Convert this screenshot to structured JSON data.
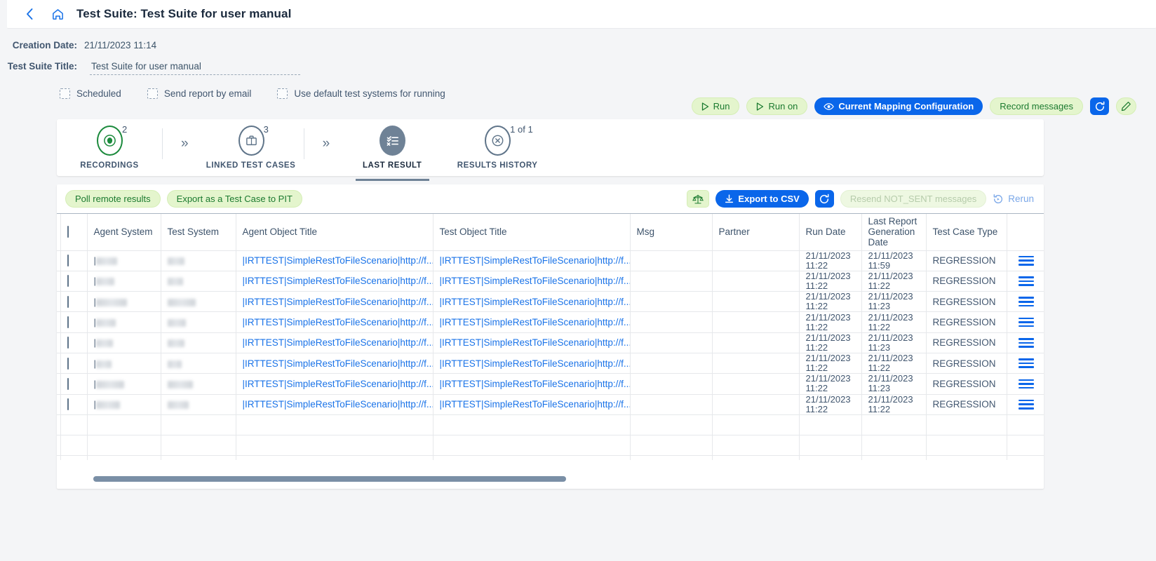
{
  "header": {
    "back_icon": "chevron-left-icon",
    "home_icon": "home-icon",
    "title": "Test Suite: Test Suite for user manual"
  },
  "meta": {
    "creation_date_label": "Creation Date:",
    "creation_date_value": "21/11/2023 11:14",
    "test_suite_title_label": "Test Suite Title:",
    "test_suite_title_value": "Test Suite for user manual",
    "checkboxes": [
      {
        "label": "Scheduled",
        "checked": false
      },
      {
        "label": "Send report by email",
        "checked": false
      },
      {
        "label": "Use default test systems for running",
        "checked": false
      }
    ]
  },
  "actions": {
    "run": "Run",
    "run_on": "Run on",
    "current_mapping_configuration": "Current Mapping Configuration",
    "record_messages": "Record messages",
    "refresh_icon": "refresh-icon",
    "edit_icon": "pencil-icon"
  },
  "stepper": {
    "steps": [
      {
        "label": "RECORDINGS",
        "badge": "2",
        "icon": "record-dot-icon",
        "style": "outline-green",
        "active": false
      },
      {
        "label": "LINKED TEST CASES",
        "badge": "3",
        "icon": "briefcase-icon",
        "style": "outline-grey",
        "active": false
      },
      {
        "label": "LAST RESULT",
        "badge": "",
        "icon": "checklist-icon",
        "style": "filled",
        "active": true
      },
      {
        "label": "RESULTS HISTORY",
        "badge": "1 of 1",
        "icon": "x-circle-icon",
        "style": "outline-grey",
        "active": false
      }
    ],
    "separator_glyph": "»"
  },
  "table_toolbar": {
    "poll_remote_results": "Poll remote results",
    "export_as_test_case_to_pit": "Export as a Test Case to PIT",
    "compare_icon": "scales-icon",
    "export_to_csv": "Export to CSV",
    "export_icon": "download-icon",
    "refresh_icon": "refresh-icon",
    "resend_not_sent_messages": "Resend NOT_SENT messages",
    "rerun": "Rerun",
    "rerun_icon": "rerun-icon"
  },
  "table": {
    "columns": [
      "Agent System",
      "Test System",
      "Agent Object Title",
      "Test Object Title",
      "Msg",
      "Partner",
      "Run Date",
      "Last Report Generation Date",
      "Test Case Type"
    ],
    "select_all_checked": false,
    "rows": [
      {
        "status": "green",
        "agent_system": "",
        "test_system": "",
        "agent_object_title": "|IRTTEST|SimpleRestToFileScenario|http://f...",
        "test_object_title": "|IRTTEST|SimpleRestToFileScenario|http://f...",
        "msg": "",
        "partner": "",
        "run_date": "21/11/2023 11:22",
        "last_report_generation_date": "21/11/2023 11:59",
        "test_case_type": "REGRESSION"
      },
      {
        "status": "red",
        "agent_system": "",
        "test_system": "",
        "agent_object_title": "|IRTTEST|SimpleRestToFileScenario|http://f...",
        "test_object_title": "|IRTTEST|SimpleRestToFileScenario|http://f...",
        "msg": "",
        "partner": "",
        "run_date": "21/11/2023 11:22",
        "last_report_generation_date": "21/11/2023 11:22",
        "test_case_type": "REGRESSION"
      },
      {
        "status": "red",
        "agent_system": "",
        "test_system": "",
        "agent_object_title": "|IRTTEST|SimpleRestToFileScenario|http://f...",
        "test_object_title": "|IRTTEST|SimpleRestToFileScenario|http://f...",
        "msg": "",
        "partner": "",
        "run_date": "21/11/2023 11:22",
        "last_report_generation_date": "21/11/2023 11:23",
        "test_case_type": "REGRESSION"
      },
      {
        "status": "red",
        "agent_system": "",
        "test_system": "",
        "agent_object_title": "|IRTTEST|SimpleRestToFileScenario|http://f...",
        "test_object_title": "|IRTTEST|SimpleRestToFileScenario|http://f...",
        "msg": "",
        "partner": "",
        "run_date": "21/11/2023 11:22",
        "last_report_generation_date": "21/11/2023 11:22",
        "test_case_type": "REGRESSION"
      },
      {
        "status": "green",
        "agent_system": "",
        "test_system": "",
        "agent_object_title": "|IRTTEST|SimpleRestToFileScenario|http://f...",
        "test_object_title": "|IRTTEST|SimpleRestToFileScenario|http://f...",
        "msg": "",
        "partner": "",
        "run_date": "21/11/2023 11:22",
        "last_report_generation_date": "21/11/2023 11:23",
        "test_case_type": "REGRESSION"
      },
      {
        "status": "green",
        "agent_system": "",
        "test_system": "",
        "agent_object_title": "|IRTTEST|SimpleRestToFileScenario|http://f...",
        "test_object_title": "|IRTTEST|SimpleRestToFileScenario|http://f...",
        "msg": "",
        "partner": "",
        "run_date": "21/11/2023 11:22",
        "last_report_generation_date": "21/11/2023 11:22",
        "test_case_type": "REGRESSION"
      },
      {
        "status": "green",
        "agent_system": "",
        "test_system": "",
        "agent_object_title": "|IRTTEST|SimpleRestToFileScenario|http://f...",
        "test_object_title": "|IRTTEST|SimpleRestToFileScenario|http://f...",
        "msg": "",
        "partner": "",
        "run_date": "21/11/2023 11:22",
        "last_report_generation_date": "21/11/2023 11:23",
        "test_case_type": "REGRESSION"
      },
      {
        "status": "green",
        "agent_system": "",
        "test_system": "",
        "agent_object_title": "|IRTTEST|SimpleRestToFileScenario|http://f...",
        "test_object_title": "|IRTTEST|SimpleRestToFileScenario|http://f...",
        "msg": "",
        "partner": "",
        "run_date": "21/11/2023 11:22",
        "last_report_generation_date": "21/11/2023 11:22",
        "test_case_type": "REGRESSION"
      }
    ],
    "empty_rows": 3,
    "row_menu_icon": "hamburger-menu-icon"
  },
  "colors": {
    "accent_blue": "#0a66ea",
    "link_blue": "#1a73e8",
    "green_button_bg": "#e4f5cd",
    "green_button_text": "#1b7a2f",
    "status_green": "#1f9443",
    "status_red": "#e8141c",
    "step_active": "#6f8296"
  }
}
